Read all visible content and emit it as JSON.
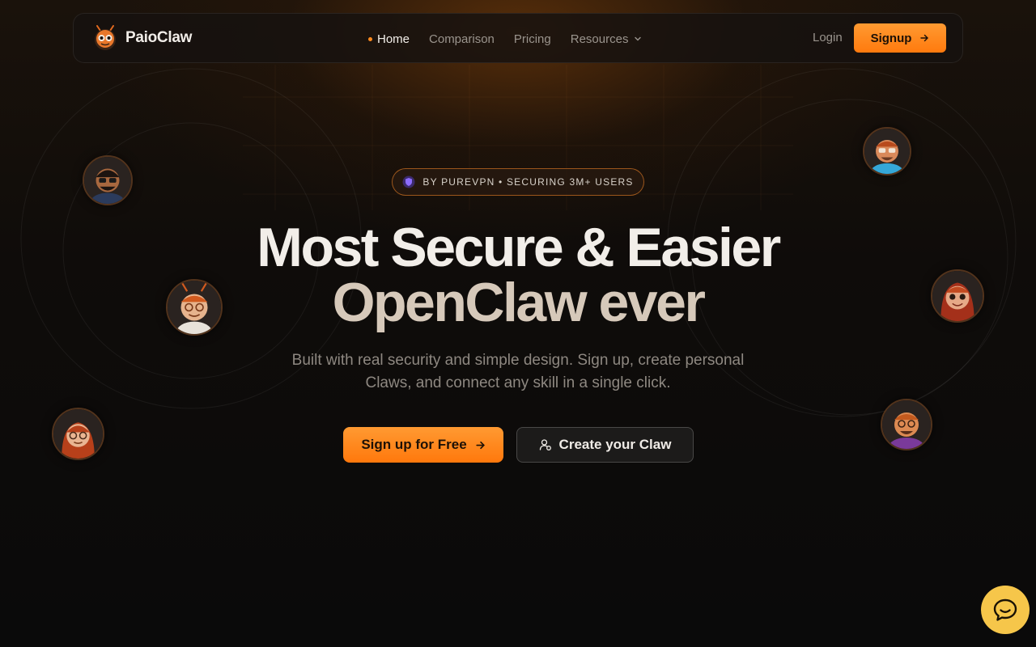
{
  "brand": {
    "name": "PaioClaw",
    "accent": "#ff8a1e"
  },
  "nav": {
    "links": [
      {
        "label": "Home",
        "active": true
      },
      {
        "label": "Comparison",
        "active": false
      },
      {
        "label": "Pricing",
        "active": false
      },
      {
        "label": "Resources",
        "active": false,
        "dropdown": true
      }
    ],
    "login_label": "Login",
    "signup_label": "Signup"
  },
  "hero": {
    "badge": "BY PUREVPN • SECURING 3M+ USERS",
    "title_line1": "Most Secure & Easier",
    "title_line2": "OpenClaw ever",
    "subtitle": "Built with real security and simple design. Sign up, create personal Claws, and connect any skill in a single click.",
    "cta_primary": "Sign up for Free",
    "cta_secondary": "Create your Claw"
  },
  "icons": {
    "logo": "ant-mascot-icon",
    "badge": "shield-icon",
    "arrow": "arrow-right-icon",
    "create": "user-add-icon",
    "chat": "chat-bubble-icon",
    "resources": "chevron-down-icon"
  },
  "colors": {
    "background": "#0b0a09",
    "primary_button": "#ff8a1e",
    "chat_button": "#f6c64a"
  }
}
